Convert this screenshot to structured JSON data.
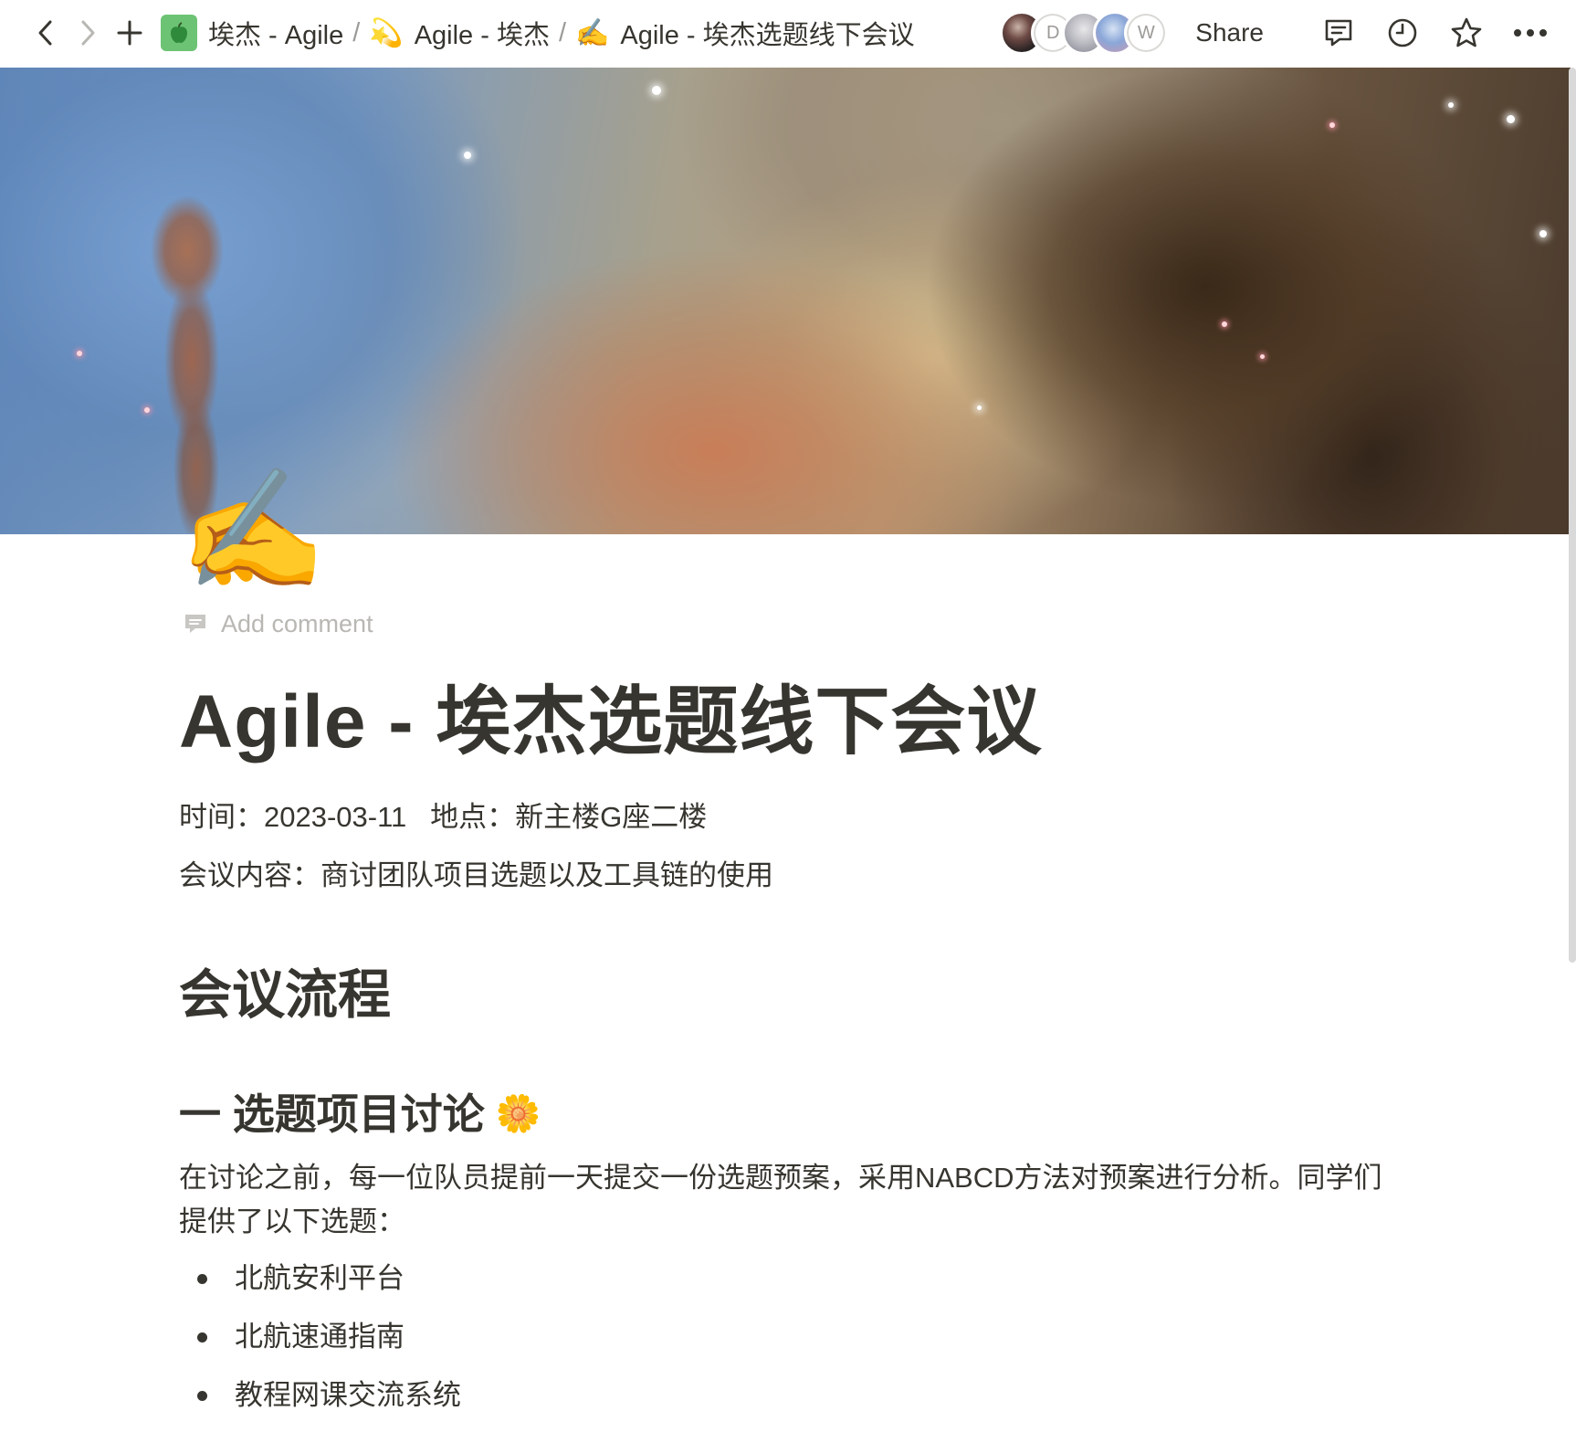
{
  "topbar": {
    "breadcrumbs": [
      {
        "label": "埃杰 - Agile",
        "icon": "green-apple-icon"
      },
      {
        "label": "Agile - 埃杰",
        "icon": "dizzy-star-icon"
      },
      {
        "label": "Agile - 埃杰选题线下会议",
        "icon": "writing-hand-icon"
      }
    ],
    "separator": "/",
    "avatars": [
      {
        "type": "photo"
      },
      {
        "type": "letter",
        "letter": "D"
      },
      {
        "type": "photo"
      },
      {
        "type": "photo"
      },
      {
        "type": "letter",
        "letter": "W"
      }
    ],
    "share_label": "Share",
    "icons": [
      "comments-icon",
      "history-clock-icon",
      "favorite-star-icon",
      "more-icon"
    ]
  },
  "page": {
    "icon_glyph": "✍️",
    "icon_name": "writing-hand-icon",
    "add_comment_label": "Add comment",
    "title": "Agile - 埃杰选题线下会议",
    "meta_line_1": "时间：2023-03-11   地点：新主楼G座二楼",
    "meta_line_2": "会议内容：商讨团队项目选题以及工具链的使用",
    "section_heading": "会议流程",
    "subsection_heading": "一 选题项目讨论",
    "subsection_emoji": "🌼",
    "paragraph": "在讨论之前，每一位队员提前一天提交一份选题预案，采用NABCD方法对预案进行分析。同学们提供了以下选题：",
    "bullets": [
      "北航安利平台",
      "北航速通指南",
      "教程网课交流系统"
    ]
  },
  "colors": {
    "text": "#37352f",
    "muted": "#b8b7b3",
    "background": "#ffffff"
  }
}
